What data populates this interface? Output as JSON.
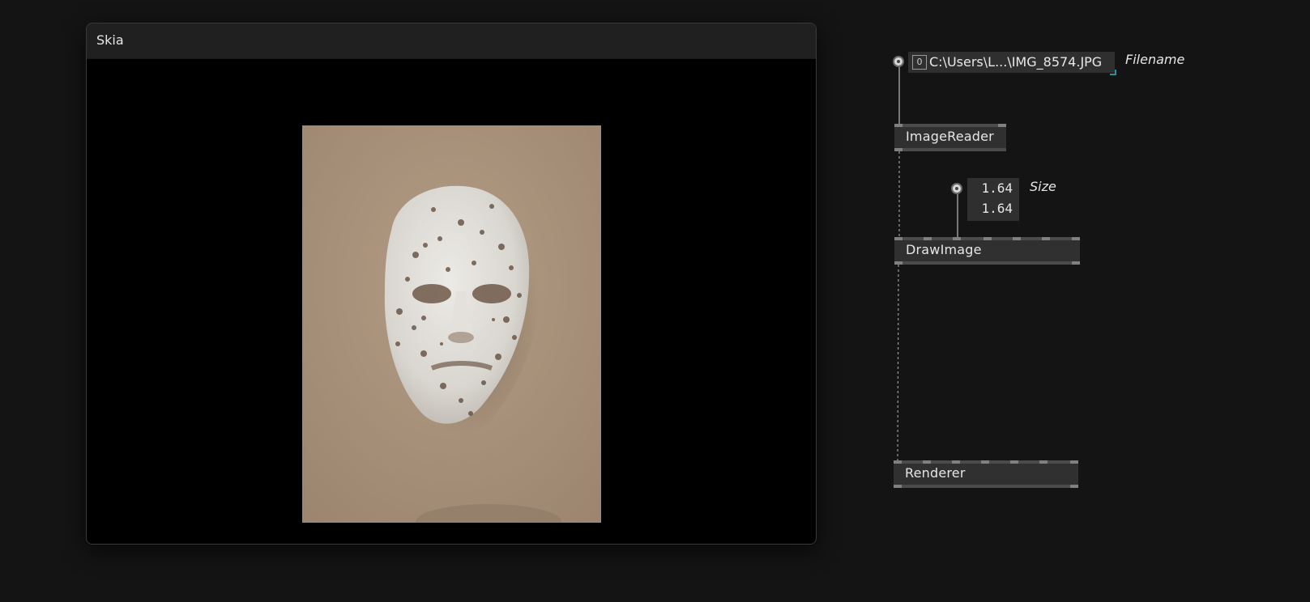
{
  "skia_window": {
    "title": "Skia"
  },
  "patch": {
    "filename_iobox": {
      "badge": "0",
      "value": "C:\\Users\\L...\\IMG_8574.JPG",
      "label": "Filename"
    },
    "size_iobox": {
      "values": [
        "1.64",
        "1.64"
      ],
      "label": "Size"
    },
    "nodes": {
      "image_reader": "ImageReader",
      "draw_image": "DrawImage",
      "renderer": "Renderer"
    }
  },
  "colors": {
    "background": "#141414",
    "node_body": "#303030",
    "node_bar": "#4b4b4b",
    "port": "#808080",
    "iobox": "#2f2f2f",
    "accent_corner": "#2f8f9a",
    "photo_paper": "#a89178"
  }
}
